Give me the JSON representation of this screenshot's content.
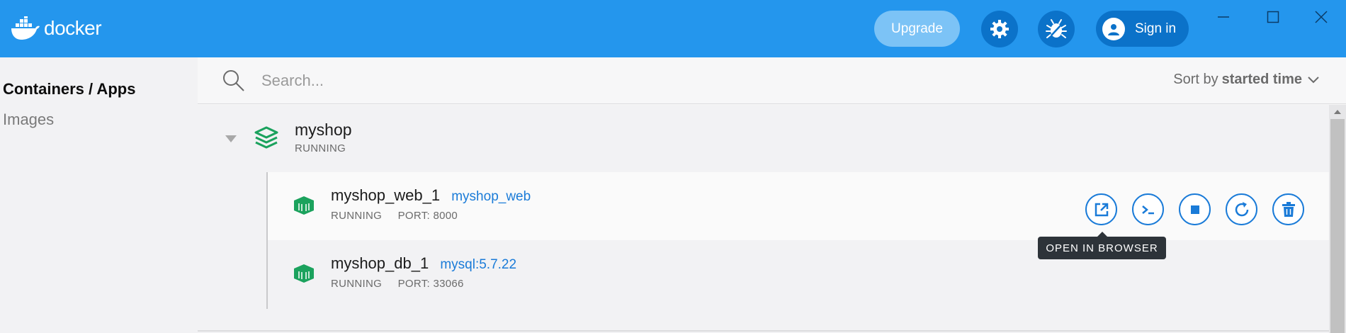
{
  "header": {
    "logo_text": "docker",
    "upgrade_label": "Upgrade",
    "settings_icon": "gear-icon",
    "troubleshoot_icon": "bug-icon",
    "signin_label": "Sign in",
    "colors": {
      "bar": "#2496ed",
      "button": "#0b72c9",
      "upgrade": "#7cc3f6"
    }
  },
  "sidebar": {
    "items": [
      {
        "label": "Containers / Apps",
        "active": true
      },
      {
        "label": "Images",
        "active": false
      }
    ]
  },
  "search": {
    "placeholder": "Search...",
    "value": ""
  },
  "sort": {
    "prefix": "Sort by",
    "value": "started time"
  },
  "app": {
    "name": "myshop",
    "status": "RUNNING",
    "containers": [
      {
        "name": "myshop_web_1",
        "image": "myshop_web",
        "status": "RUNNING",
        "port": "PORT: 8000"
      },
      {
        "name": "myshop_db_1",
        "image": "mysql:5.7.22",
        "status": "RUNNING",
        "port": "PORT: 33066"
      }
    ]
  },
  "actions": [
    {
      "name": "open-in-browser",
      "icon": "external-link-icon"
    },
    {
      "name": "cli",
      "icon": "terminal-icon"
    },
    {
      "name": "stop",
      "icon": "stop-icon"
    },
    {
      "name": "restart",
      "icon": "restart-icon"
    },
    {
      "name": "delete",
      "icon": "trash-icon"
    }
  ],
  "tooltip": "OPEN IN BROWSER",
  "accent_color": "#1a7bd8",
  "running_color": "#1ba25d"
}
